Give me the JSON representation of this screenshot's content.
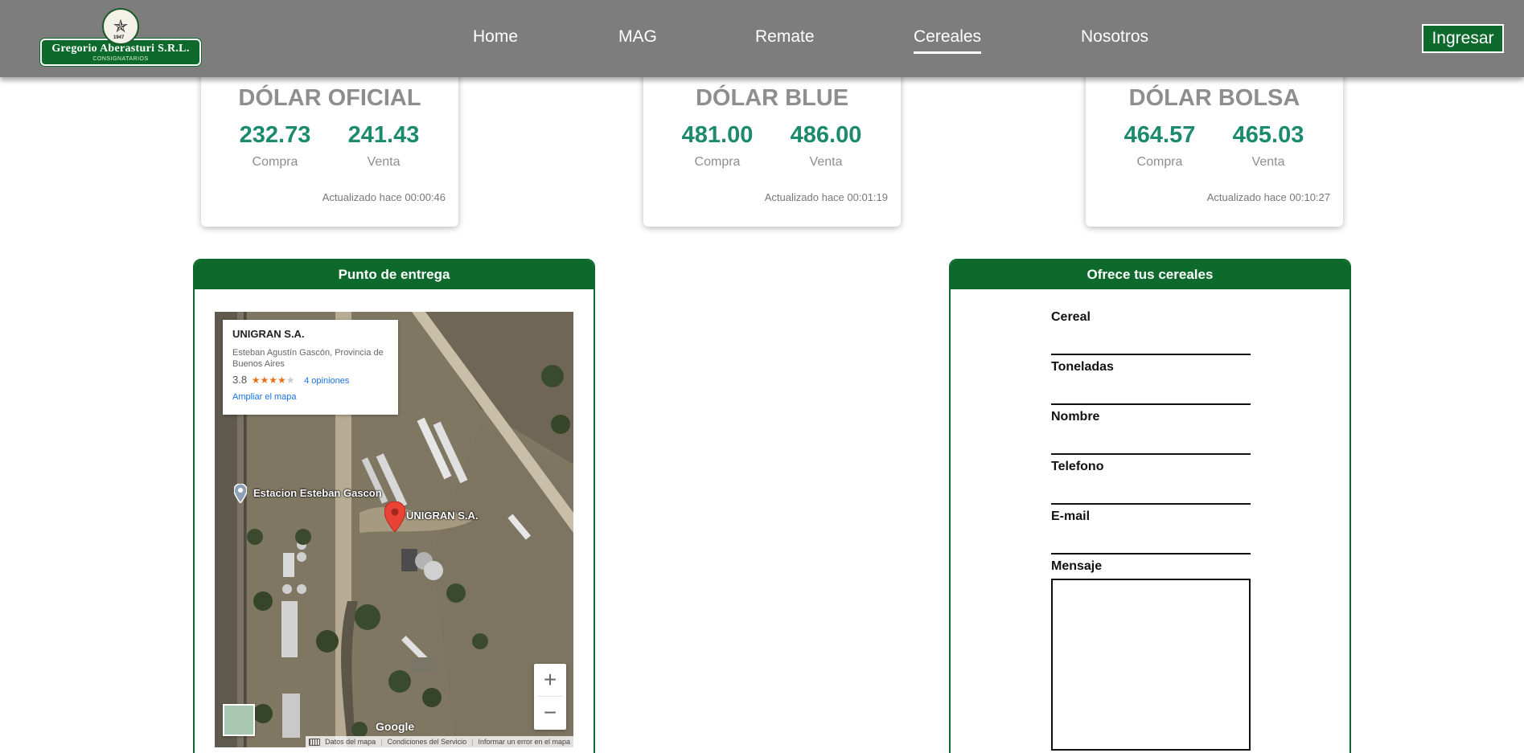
{
  "header": {
    "logo": {
      "name": "Gregorio Aberasturi S.R.L.",
      "subtitle": "CONSIGNATARIOS",
      "year": "1947",
      "emblem_icon": "star-emblem-icon"
    },
    "nav": [
      {
        "label": "Home"
      },
      {
        "label": "MAG"
      },
      {
        "label": "Remate"
      },
      {
        "label": "Cereales",
        "active": true
      },
      {
        "label": "Nosotros"
      }
    ],
    "login_label": "Ingresar"
  },
  "rates": [
    {
      "title": "DÓLAR OFICIAL",
      "compra": "232.73",
      "venta": "241.43",
      "compra_label": "Compra",
      "venta_label": "Venta",
      "updated": "Actualizado hace 00:00:46"
    },
    {
      "title": "DÓLAR BLUE",
      "compra": "481.00",
      "venta": "486.00",
      "compra_label": "Compra",
      "venta_label": "Venta",
      "updated": "Actualizado hace 00:01:19"
    },
    {
      "title": "DÓLAR BOLSA",
      "compra": "464.57",
      "venta": "465.03",
      "compra_label": "Compra",
      "venta_label": "Venta",
      "updated": "Actualizado hace 00:10:27"
    }
  ],
  "delivery": {
    "title": "Punto de entrega",
    "map": {
      "place_name": "UNIGRAN S.A.",
      "address": "Esteban Agustín Gascón, Provincia de Buenos Aires",
      "rating": "3.8",
      "rating_value": 3.8,
      "reviews": "4 opiniones",
      "enlarge_link": "Ampliar el mapa",
      "station_label": "Estacion Esteban Gascon",
      "marker_label": "UNIGRAN S.A.",
      "zoom_in": "+",
      "zoom_out": "−",
      "google": "Google",
      "attribution": [
        "Datos del mapa",
        "Condiciones del Servicio",
        "Informar un error en el mapa"
      ]
    }
  },
  "offer": {
    "title": "Ofrece tus cereales",
    "fields": [
      {
        "label": "Cereal"
      },
      {
        "label": "Toneladas"
      },
      {
        "label": "Nombre"
      },
      {
        "label": "Telefono"
      },
      {
        "label": "E-mail"
      },
      {
        "label": "Mensaje"
      }
    ]
  },
  "colors": {
    "brand_green": "#0e6a2c",
    "nav_gray": "#7d7d7d",
    "rate_teal": "#1c8a6c",
    "muted_gray": "#8e8e8e"
  }
}
